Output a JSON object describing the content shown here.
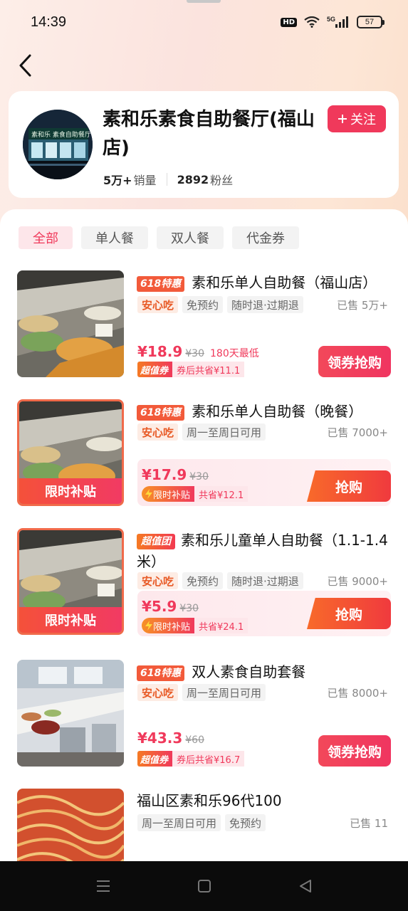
{
  "status_bar": {
    "time": "14:39",
    "hd": "HD",
    "network": "5G",
    "battery": "57"
  },
  "store": {
    "name": "素和乐素食自助餐厅(福山店)",
    "follow_label": "关注",
    "sales_value": "5万+",
    "sales_label": "销量",
    "fans_value": "2892",
    "fans_label": "粉丝",
    "sign_text": "素和乐 素食自助餐厅"
  },
  "tabs": [
    {
      "label": "全部",
      "active": true
    },
    {
      "label": "单人餐",
      "active": false
    },
    {
      "label": "双人餐",
      "active": false
    },
    {
      "label": "代金券",
      "active": false
    }
  ],
  "items": [
    {
      "badge": "618特惠",
      "title": "素和乐单人自助餐（福山店）",
      "safe": "安心吃",
      "chips": [
        "免预约",
        "随时退·过期退"
      ],
      "sold": "已售 5万+",
      "price": "¥18.9",
      "orig": "¥30",
      "low": "180天最低",
      "coupon_badge": "超值券",
      "coupon_text": "券后共省¥11.1",
      "buy": "领券抢购"
    },
    {
      "badge": "618特惠",
      "title": "素和乐单人自助餐（晚餐）",
      "safe": "安心吃",
      "chips": [
        "周一至周日可用"
      ],
      "sold": "已售 7000+",
      "thumb_label": "限时补贴",
      "price": "¥17.9",
      "orig": "¥30",
      "subsidy_badge": "限时补贴",
      "subsidy_text": "共省¥12.1",
      "buy": "抢购"
    },
    {
      "badge": "超值团",
      "title": "素和乐儿童单人自助餐（1.1-1.4米）",
      "safe": "安心吃",
      "chips": [
        "免预约",
        "随时退·过期退"
      ],
      "sold": "已售 9000+",
      "thumb_label": "限时补贴",
      "price": "¥5.9",
      "orig": "¥30",
      "subsidy_badge": "限时补贴",
      "subsidy_text": "共省¥24.1",
      "buy": "抢购"
    },
    {
      "badge": "618特惠",
      "title": "双人素食自助套餐",
      "safe": "安心吃",
      "chips": [
        "周一至周日可用"
      ],
      "sold": "已售 8000+",
      "price": "¥43.3",
      "orig": "¥60",
      "coupon_badge": "超值券",
      "coupon_text": "券后共省¥16.7",
      "buy": "领券抢购"
    },
    {
      "title": "福山区素和乐96代100",
      "chips": [
        "周一至周日可用",
        "免预约"
      ],
      "sold": "已售 11"
    }
  ],
  "icons": {
    "back": "back-arrow-icon",
    "follow": "plus-icon",
    "nav": [
      "menu-icon",
      "home-square-icon",
      "back-triangle-icon"
    ]
  },
  "colors": {
    "accent": "#f0395b",
    "orange": "#f25a3a"
  }
}
